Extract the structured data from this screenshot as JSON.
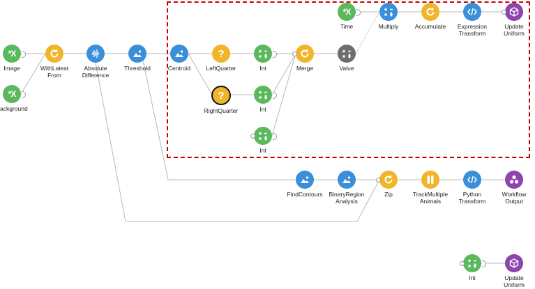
{
  "colors": {
    "source": "#5cb85c",
    "combinator": "#f0b52b",
    "transform": "#3a8fd9",
    "sink": "#8e44ad",
    "dark": "#6d6d6d",
    "group_border": "#cc0000",
    "edge": "#b8b8b8"
  },
  "nodes": [
    {
      "id": "image",
      "label": "Image",
      "kind": "source",
      "icon": "subject-icon"
    },
    {
      "id": "background",
      "label": "Background",
      "kind": "source",
      "icon": "subject-icon"
    },
    {
      "id": "withlatestfrom",
      "label": "WithLatest\nFrom",
      "kind": "combinator",
      "icon": "cycle-icon"
    },
    {
      "id": "absdiff",
      "label": "Absolute\nDifference",
      "kind": "transform",
      "icon": "waveform-icon"
    },
    {
      "id": "threshold",
      "label": "Threshold",
      "kind": "transform",
      "icon": "image-icon"
    },
    {
      "id": "centroid",
      "label": "Centroid",
      "kind": "transform",
      "icon": "image-icon"
    },
    {
      "id": "leftquarter",
      "label": "LeftQuarter",
      "kind": "combinator",
      "icon": "question-icon"
    },
    {
      "id": "rightquarter",
      "label": "RightQuarter",
      "kind": "combinator",
      "icon": "question-icon",
      "selected": true
    },
    {
      "id": "int1",
      "label": "Int",
      "kind": "source",
      "icon": "operators-icon"
    },
    {
      "id": "int2",
      "label": "Int",
      "kind": "source",
      "icon": "operators-icon"
    },
    {
      "id": "int3",
      "label": "Int",
      "kind": "source",
      "icon": "operators-icon"
    },
    {
      "id": "merge",
      "label": "Merge",
      "kind": "combinator",
      "icon": "cycle-icon"
    },
    {
      "id": "value",
      "label": "Value",
      "kind": "dark",
      "icon": "operators-icon"
    },
    {
      "id": "time",
      "label": "Time",
      "kind": "source",
      "icon": "subject-icon"
    },
    {
      "id": "multiply",
      "label": "Multiply",
      "kind": "transform",
      "icon": "operators-icon"
    },
    {
      "id": "accumulate",
      "label": "Accumulate",
      "kind": "combinator",
      "icon": "cycle-icon"
    },
    {
      "id": "exprtransform",
      "label": "Expression\nTransform",
      "kind": "transform",
      "icon": "code-icon"
    },
    {
      "id": "updateuniform1",
      "label": "Update\nUniform",
      "kind": "sink",
      "icon": "cube-icon"
    },
    {
      "id": "findcontours",
      "label": "FindContours",
      "kind": "transform",
      "icon": "image-icon"
    },
    {
      "id": "binaryregion",
      "label": "BinaryRegion\nAnalysis",
      "kind": "transform",
      "icon": "image-icon"
    },
    {
      "id": "zip",
      "label": "Zip",
      "kind": "combinator",
      "icon": "cycle-icon"
    },
    {
      "id": "trackmultiple",
      "label": "TrackMultiple\nAnimals",
      "kind": "combinator",
      "icon": "split-icon"
    },
    {
      "id": "pythontransform",
      "label": "Python\nTransform",
      "kind": "transform",
      "icon": "code-icon"
    },
    {
      "id": "workflowoutput",
      "label": "Workflow\nOutput",
      "kind": "sink",
      "icon": "cluster-icon"
    },
    {
      "id": "int4",
      "label": "Int",
      "kind": "source",
      "icon": "operators-icon"
    },
    {
      "id": "updateuniform2",
      "label": "Update\nUniform",
      "kind": "sink",
      "icon": "cube-icon"
    }
  ],
  "edges": [
    [
      "image",
      "withlatestfrom"
    ],
    [
      "background",
      "withlatestfrom"
    ],
    [
      "withlatestfrom",
      "absdiff"
    ],
    [
      "absdiff",
      "threshold"
    ],
    [
      "absdiff",
      "zip"
    ],
    [
      "threshold",
      "centroid"
    ],
    [
      "threshold",
      "findcontours"
    ],
    [
      "centroid",
      "leftquarter"
    ],
    [
      "centroid",
      "rightquarter"
    ],
    [
      "leftquarter",
      "int1"
    ],
    [
      "rightquarter",
      "int2"
    ],
    [
      "int1",
      "merge"
    ],
    [
      "int2",
      "merge"
    ],
    [
      "int3",
      "merge"
    ],
    [
      "merge",
      "value"
    ],
    [
      "value",
      "multiply",
      "dashed"
    ],
    [
      "time",
      "multiply"
    ],
    [
      "multiply",
      "accumulate"
    ],
    [
      "accumulate",
      "exprtransform"
    ],
    [
      "exprtransform",
      "updateuniform1"
    ],
    [
      "findcontours",
      "binaryregion"
    ],
    [
      "binaryregion",
      "zip"
    ],
    [
      "zip",
      "trackmultiple"
    ],
    [
      "trackmultiple",
      "pythontransform"
    ],
    [
      "pythontransform",
      "workflowoutput"
    ],
    [
      "int4",
      "updateuniform2"
    ]
  ]
}
